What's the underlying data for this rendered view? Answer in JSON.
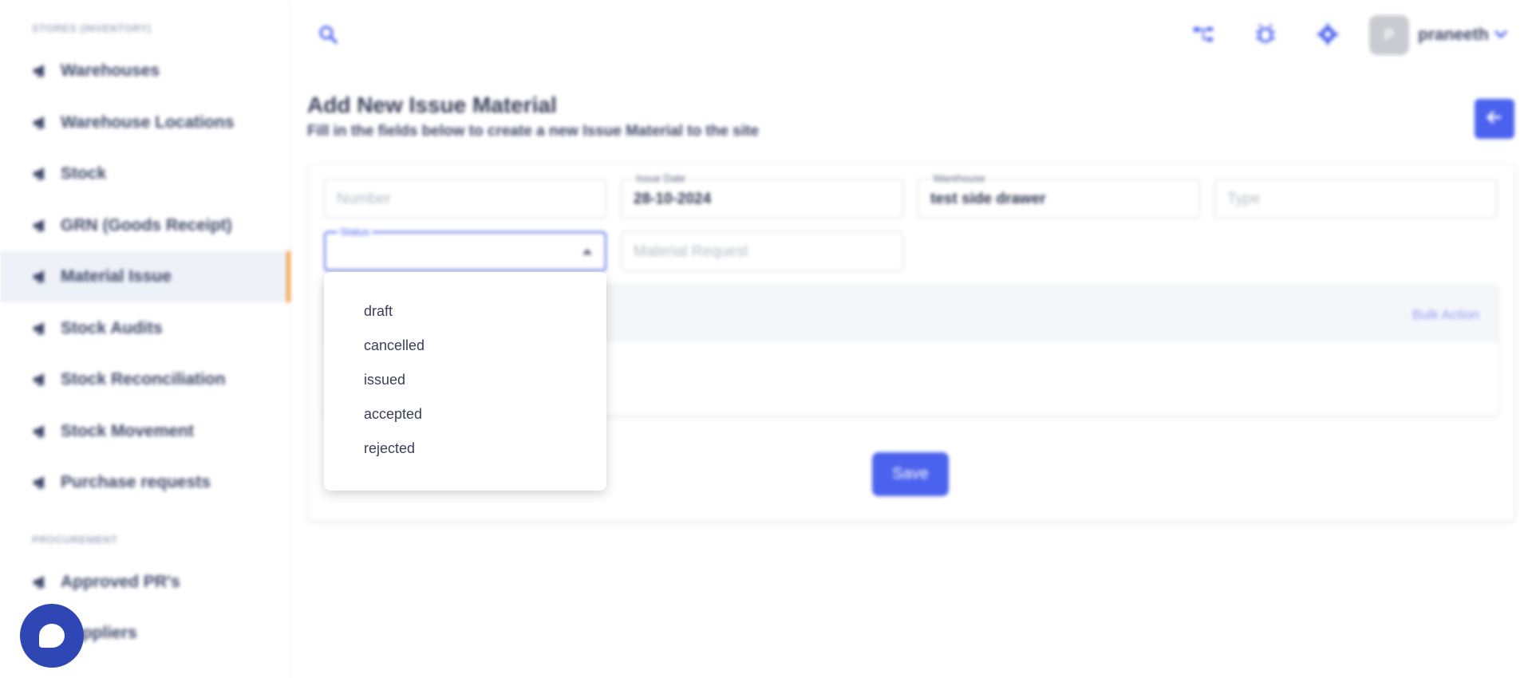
{
  "sidebar": {
    "section_inventory": "STORES (INVENTORY)",
    "items": [
      {
        "label": "Warehouses"
      },
      {
        "label": "Warehouse Locations"
      },
      {
        "label": "Stock"
      },
      {
        "label": "GRN (Goods Receipt)"
      },
      {
        "label": "Material Issue"
      },
      {
        "label": "Stock Audits"
      },
      {
        "label": "Stock Reconciliation"
      },
      {
        "label": "Stock Movement"
      },
      {
        "label": "Purchase requests"
      }
    ],
    "section_procurement": "PROCUREMENT",
    "procurement_items": [
      {
        "label": "Approved PR's"
      },
      {
        "label": "Suppliers"
      }
    ],
    "active_item": "Material Issue"
  },
  "topbar": {
    "user_initial": "P",
    "username": "praneeth",
    "icons": [
      "search-icon",
      "hierarchy-icon",
      "bug-icon",
      "gear-icon",
      "chevron-down-icon"
    ]
  },
  "page": {
    "title": "Add New Issue Material",
    "subtitle": "Fill in the fields below to create a new Issue Material to the site"
  },
  "form": {
    "number_placeholder": "Number",
    "issue_date_label": "Issue Date",
    "issue_date_value": "28-10-2024",
    "warehouse_label": "Warehouse",
    "warehouse_value": "test side drawer",
    "type_placeholder": "Type",
    "status_label": "Status",
    "status_value": "",
    "material_request_placeholder": "Material Request",
    "bulk_action": "Bulk Action",
    "save_label": "Save"
  },
  "status_dropdown": {
    "options": [
      "draft",
      "cancelled",
      "issued",
      "accepted",
      "rejected"
    ]
  },
  "colors": {
    "accent": "#4b62ee",
    "active_marker": "#f4a24a",
    "chat": "#2f47b4"
  }
}
